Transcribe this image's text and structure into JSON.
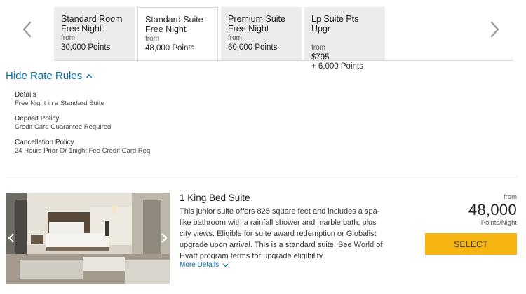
{
  "rate_tabs": [
    {
      "name_line1": "Standard Room",
      "name_line2": "Free Night",
      "from": "from",
      "value_line1": "30,000 Points",
      "value_line2": ""
    },
    {
      "name_line1": "Standard Suite",
      "name_line2": "Free Night",
      "from": "from",
      "value_line1": "48,000 Points",
      "value_line2": ""
    },
    {
      "name_line1": "Premium Suite",
      "name_line2": "Free Night",
      "from": "from",
      "value_line1": "60,000 Points",
      "value_line2": ""
    },
    {
      "name_line1": "Lp Suite Pts Upgr",
      "name_line2": "",
      "from": "from",
      "value_line1": "$795",
      "value_line2": "+ 6,000 Points"
    }
  ],
  "active_tab_index": 1,
  "rate_rules": {
    "toggle_label": "Hide Rate Rules",
    "items": [
      {
        "title": "Details",
        "text": "Free Night in a Standard Suite"
      },
      {
        "title": "Deposit Policy",
        "text": "Credit Card Guarantee Required"
      },
      {
        "title": "Cancellation Policy",
        "text": "24 Hours Prior Or 1night Fee Credit Card Req"
      }
    ]
  },
  "room": {
    "title": "1 King Bed Suite",
    "description": "This junior suite offers 825 square feet and includes a spa-like bathroom with a rainfall shower and marble bath, plus city views. Eligible for suite award redemption or Globalist upgrade upon arrival. This is a standard suite. See World of Hyatt program terms for upgrade eligibility.",
    "more_details_label": "More Details",
    "price_from": "from",
    "price_value": "48,000",
    "price_unit": "Points/Night",
    "select_label": "SELECT"
  },
  "colors": {
    "link": "#0b6fa8",
    "select_button": "#f5b40f",
    "tab_inactive": "#ececec"
  },
  "icons": {
    "carousel_prev": "chevron-left-icon",
    "carousel_next": "chevron-right-icon",
    "rules_toggle": "chevron-up-icon",
    "more_details": "chevron-down-icon"
  }
}
